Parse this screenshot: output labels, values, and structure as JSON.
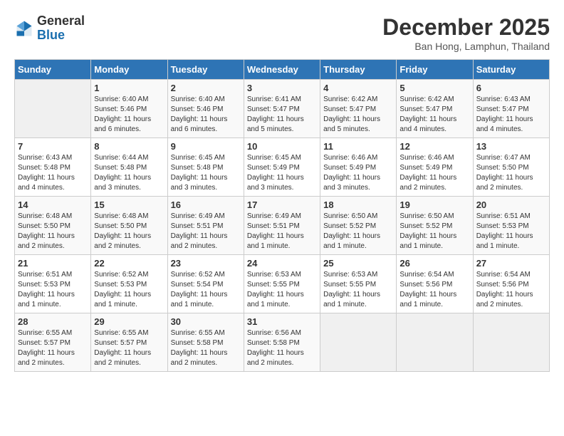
{
  "logo": {
    "general": "General",
    "blue": "Blue"
  },
  "header": {
    "title": "December 2025",
    "subtitle": "Ban Hong, Lamphun, Thailand"
  },
  "weekdays": [
    "Sunday",
    "Monday",
    "Tuesday",
    "Wednesday",
    "Thursday",
    "Friday",
    "Saturday"
  ],
  "weeks": [
    [
      {
        "day": "",
        "sunrise": "",
        "sunset": "",
        "daylight": ""
      },
      {
        "day": "1",
        "sunrise": "Sunrise: 6:40 AM",
        "sunset": "Sunset: 5:46 PM",
        "daylight": "Daylight: 11 hours and 6 minutes."
      },
      {
        "day": "2",
        "sunrise": "Sunrise: 6:40 AM",
        "sunset": "Sunset: 5:46 PM",
        "daylight": "Daylight: 11 hours and 6 minutes."
      },
      {
        "day": "3",
        "sunrise": "Sunrise: 6:41 AM",
        "sunset": "Sunset: 5:47 PM",
        "daylight": "Daylight: 11 hours and 5 minutes."
      },
      {
        "day": "4",
        "sunrise": "Sunrise: 6:42 AM",
        "sunset": "Sunset: 5:47 PM",
        "daylight": "Daylight: 11 hours and 5 minutes."
      },
      {
        "day": "5",
        "sunrise": "Sunrise: 6:42 AM",
        "sunset": "Sunset: 5:47 PM",
        "daylight": "Daylight: 11 hours and 4 minutes."
      },
      {
        "day": "6",
        "sunrise": "Sunrise: 6:43 AM",
        "sunset": "Sunset: 5:47 PM",
        "daylight": "Daylight: 11 hours and 4 minutes."
      }
    ],
    [
      {
        "day": "7",
        "sunrise": "Sunrise: 6:43 AM",
        "sunset": "Sunset: 5:48 PM",
        "daylight": "Daylight: 11 hours and 4 minutes."
      },
      {
        "day": "8",
        "sunrise": "Sunrise: 6:44 AM",
        "sunset": "Sunset: 5:48 PM",
        "daylight": "Daylight: 11 hours and 3 minutes."
      },
      {
        "day": "9",
        "sunrise": "Sunrise: 6:45 AM",
        "sunset": "Sunset: 5:48 PM",
        "daylight": "Daylight: 11 hours and 3 minutes."
      },
      {
        "day": "10",
        "sunrise": "Sunrise: 6:45 AM",
        "sunset": "Sunset: 5:49 PM",
        "daylight": "Daylight: 11 hours and 3 minutes."
      },
      {
        "day": "11",
        "sunrise": "Sunrise: 6:46 AM",
        "sunset": "Sunset: 5:49 PM",
        "daylight": "Daylight: 11 hours and 3 minutes."
      },
      {
        "day": "12",
        "sunrise": "Sunrise: 6:46 AM",
        "sunset": "Sunset: 5:49 PM",
        "daylight": "Daylight: 11 hours and 2 minutes."
      },
      {
        "day": "13",
        "sunrise": "Sunrise: 6:47 AM",
        "sunset": "Sunset: 5:50 PM",
        "daylight": "Daylight: 11 hours and 2 minutes."
      }
    ],
    [
      {
        "day": "14",
        "sunrise": "Sunrise: 6:48 AM",
        "sunset": "Sunset: 5:50 PM",
        "daylight": "Daylight: 11 hours and 2 minutes."
      },
      {
        "day": "15",
        "sunrise": "Sunrise: 6:48 AM",
        "sunset": "Sunset: 5:50 PM",
        "daylight": "Daylight: 11 hours and 2 minutes."
      },
      {
        "day": "16",
        "sunrise": "Sunrise: 6:49 AM",
        "sunset": "Sunset: 5:51 PM",
        "daylight": "Daylight: 11 hours and 2 minutes."
      },
      {
        "day": "17",
        "sunrise": "Sunrise: 6:49 AM",
        "sunset": "Sunset: 5:51 PM",
        "daylight": "Daylight: 11 hours and 1 minute."
      },
      {
        "day": "18",
        "sunrise": "Sunrise: 6:50 AM",
        "sunset": "Sunset: 5:52 PM",
        "daylight": "Daylight: 11 hours and 1 minute."
      },
      {
        "day": "19",
        "sunrise": "Sunrise: 6:50 AM",
        "sunset": "Sunset: 5:52 PM",
        "daylight": "Daylight: 11 hours and 1 minute."
      },
      {
        "day": "20",
        "sunrise": "Sunrise: 6:51 AM",
        "sunset": "Sunset: 5:53 PM",
        "daylight": "Daylight: 11 hours and 1 minute."
      }
    ],
    [
      {
        "day": "21",
        "sunrise": "Sunrise: 6:51 AM",
        "sunset": "Sunset: 5:53 PM",
        "daylight": "Daylight: 11 hours and 1 minute."
      },
      {
        "day": "22",
        "sunrise": "Sunrise: 6:52 AM",
        "sunset": "Sunset: 5:53 PM",
        "daylight": "Daylight: 11 hours and 1 minute."
      },
      {
        "day": "23",
        "sunrise": "Sunrise: 6:52 AM",
        "sunset": "Sunset: 5:54 PM",
        "daylight": "Daylight: 11 hours and 1 minute."
      },
      {
        "day": "24",
        "sunrise": "Sunrise: 6:53 AM",
        "sunset": "Sunset: 5:55 PM",
        "daylight": "Daylight: 11 hours and 1 minute."
      },
      {
        "day": "25",
        "sunrise": "Sunrise: 6:53 AM",
        "sunset": "Sunset: 5:55 PM",
        "daylight": "Daylight: 11 hours and 1 minute."
      },
      {
        "day": "26",
        "sunrise": "Sunrise: 6:54 AM",
        "sunset": "Sunset: 5:56 PM",
        "daylight": "Daylight: 11 hours and 1 minute."
      },
      {
        "day": "27",
        "sunrise": "Sunrise: 6:54 AM",
        "sunset": "Sunset: 5:56 PM",
        "daylight": "Daylight: 11 hours and 2 minutes."
      }
    ],
    [
      {
        "day": "28",
        "sunrise": "Sunrise: 6:55 AM",
        "sunset": "Sunset: 5:57 PM",
        "daylight": "Daylight: 11 hours and 2 minutes."
      },
      {
        "day": "29",
        "sunrise": "Sunrise: 6:55 AM",
        "sunset": "Sunset: 5:57 PM",
        "daylight": "Daylight: 11 hours and 2 minutes."
      },
      {
        "day": "30",
        "sunrise": "Sunrise: 6:55 AM",
        "sunset": "Sunset: 5:58 PM",
        "daylight": "Daylight: 11 hours and 2 minutes."
      },
      {
        "day": "31",
        "sunrise": "Sunrise: 6:56 AM",
        "sunset": "Sunset: 5:58 PM",
        "daylight": "Daylight: 11 hours and 2 minutes."
      },
      {
        "day": "",
        "sunrise": "",
        "sunset": "",
        "daylight": ""
      },
      {
        "day": "",
        "sunrise": "",
        "sunset": "",
        "daylight": ""
      },
      {
        "day": "",
        "sunrise": "",
        "sunset": "",
        "daylight": ""
      }
    ]
  ]
}
